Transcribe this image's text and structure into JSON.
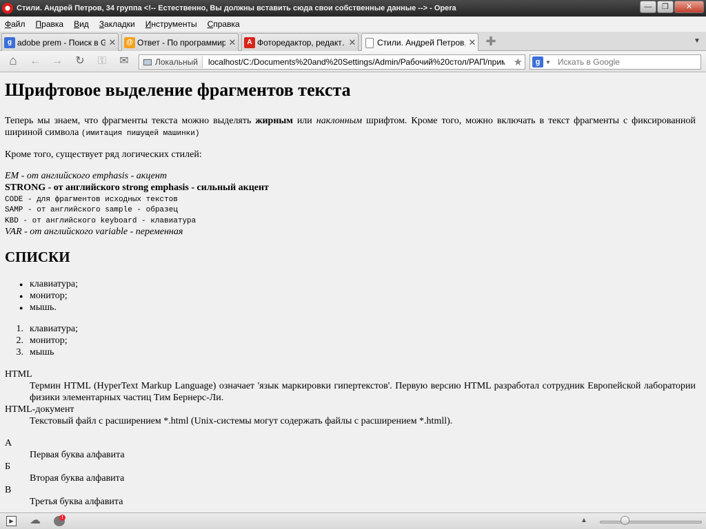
{
  "window": {
    "title": "Стили. Андрей Петров, 34 группа <!-- Естественно, Вы должны вставить сюда свои собственные данные --> - Opera",
    "minimize": "—",
    "maximize": "❐",
    "close": "✕"
  },
  "menu": [
    {
      "label": "Файл",
      "u": "Ф",
      "rest": "айл"
    },
    {
      "label": "Правка",
      "u": "П",
      "rest": "равка"
    },
    {
      "label": "Вид",
      "u": "В",
      "rest": "ид"
    },
    {
      "label": "Закладки",
      "u": "З",
      "rest": "акладки"
    },
    {
      "label": "Инструменты",
      "u": "И",
      "rest": "нструменты"
    },
    {
      "label": "Справка",
      "u": "С",
      "rest": "правка"
    }
  ],
  "tabs": [
    {
      "label": "adobe prem - Поиск в G…",
      "icon": "google-icon",
      "icon_color": "#3c6fd9",
      "icon_glyph": "g"
    },
    {
      "label": "Ответ - По программир…",
      "icon": "mail-ru-icon",
      "icon_color": "#f4a11d",
      "icon_glyph": "@"
    },
    {
      "label": "Фоторедактор, редакт…",
      "icon": "adobe-icon",
      "icon_color": "#d8251c",
      "icon_glyph": "A"
    },
    {
      "label": "Стили. Андрей Петров,…",
      "icon": "document-icon",
      "icon_color": "#ffffff",
      "icon_glyph": ""
    }
  ],
  "tab_close_glyph": "✕",
  "new_tab_glyph": "✚",
  "tab_menu_glyph": "▼",
  "nav": {
    "home": "⌂",
    "back": "←",
    "forward": "→",
    "reload": "↻",
    "key": "⚿",
    "mail": "✉",
    "badge": "Локальный",
    "url": "localhost/C:/Documents%20and%20Settings/Admin/Рабочий%20стол/РАП/пример1.htm",
    "star": "★",
    "search_placeholder": "Искать в Google",
    "google_glyph": "g",
    "search_drop": "▼"
  },
  "page": {
    "h1": "Шрифтовое выделение фрагментов текста",
    "p1_a": "Теперь мы знаем, что фрагменты текста можно выделять ",
    "p1_bold": "жирным",
    "p1_b": " или ",
    "p1_italic": "наклонным",
    "p1_c": " шрифтом. Кроме того, можно включать в текст фрагменты с фиксированной шириной символа ",
    "p1_mono": "(имитация пишущей машинки)",
    "p2": "Кроме того, существует ряд логических стилей:",
    "em_line": "EM - от английского emphasis - акцент",
    "strong_line": "STRONG - от английского strong emphasis - сильный акцент",
    "code_line": "CODE - для фрагментов исходных текстов",
    "samp_line": "SAMP - от английского sample - образец",
    "kbd_line": "KBD - от английского keyboard - клавиатура",
    "var_line": "VAR - от английского variable - переменная",
    "h2": "СПИСКИ",
    "ul": [
      "клавиатура;",
      "монитор;",
      "мышь."
    ],
    "ol": [
      "клавиатура;",
      "монитор;",
      "мышь"
    ],
    "dl1": [
      {
        "term": "HTML",
        "def": "Термин HTML (HyperText Markup Language) означает 'язык маркировки гипертекстов'. Первую версию HTML разработал сотрудник Европейской лаборатории физики элементарных частиц Тим Бернерс-Ли."
      },
      {
        "term": "HTML-документ",
        "def": "Текстовый файл с расширением *.html (Unix-системы могут содержать файлы с расширением *.htmll)."
      }
    ],
    "dl2": [
      {
        "term": "А",
        "def": "Первая буква алфавита"
      },
      {
        "term": "Б",
        "def": "Вторая буква алфавита"
      },
      {
        "term": "В",
        "def": "Третья буква алфавита"
      }
    ],
    "bullet_glyph": "●"
  },
  "status": {
    "panel_glyph": "▶",
    "cloud_glyph": "☁",
    "up_glyph": "▲",
    "zoom_level": 0.25
  }
}
